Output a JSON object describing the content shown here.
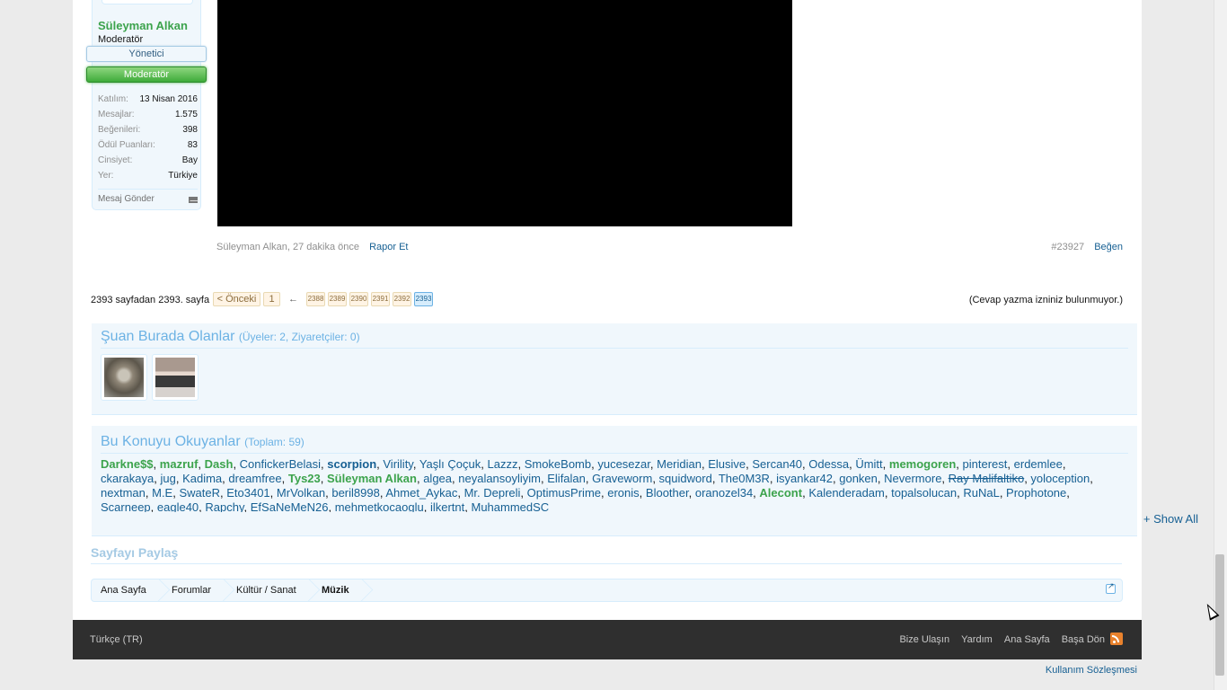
{
  "post": {
    "user": {
      "name": "Süleyman Alkan",
      "title": "Moderatör",
      "banners": [
        "Yönetici",
        "Moderatör"
      ],
      "stats": [
        {
          "label": "Katılım:",
          "value": "13 Nisan 2016"
        },
        {
          "label": "Mesajlar:",
          "value": "1.575"
        },
        {
          "label": "Beğenileri:",
          "value": "398"
        },
        {
          "label": "Ödül Puanları:",
          "value": "83"
        },
        {
          "label": "Cinsiyet:",
          "value": "Bay"
        },
        {
          "label": "Yer:",
          "value": "Türkiye"
        }
      ],
      "send_message": "Mesaj Gönder"
    },
    "meta": {
      "author_time": "Süleyman Alkan, 27 dakika önce",
      "report": "Rapor Et",
      "post_number": "#23927",
      "like": "Beğen"
    }
  },
  "pagination": {
    "label": "2393 sayfadan 2393. sayfa",
    "prev": "< Önceki",
    "first": "1",
    "skip": "←",
    "pages": [
      "2388",
      "2389",
      "2390",
      "2391",
      "2392",
      "2393"
    ],
    "current": "2393",
    "no_reply": "(Cevap yazma izniniz bulunmuyor.)"
  },
  "online": {
    "title": "Şuan Burada Olanlar",
    "count": "(Üyeler: 2, Ziyaretçiler: 0)"
  },
  "readers": {
    "title": "Bu Konuyu Okuyanlar",
    "count": "(Toplam: 59)",
    "users": [
      {
        "n": "Darkne$$",
        "s": "mod"
      },
      {
        "n": "mazruf",
        "s": "mod"
      },
      {
        "n": "Dash",
        "s": "mod"
      },
      {
        "n": "ConfickerBelasi",
        "s": ""
      },
      {
        "n": "scorpion",
        "s": "bold"
      },
      {
        "n": "Virility",
        "s": ""
      },
      {
        "n": "Yaşlı Çoçuk",
        "s": ""
      },
      {
        "n": "Lazzz",
        "s": ""
      },
      {
        "n": "SmokeBomb",
        "s": ""
      },
      {
        "n": "yucesezar",
        "s": ""
      },
      {
        "n": "Meridian",
        "s": ""
      },
      {
        "n": "Elusive",
        "s": ""
      },
      {
        "n": "Sercan40",
        "s": ""
      },
      {
        "n": "Odessa",
        "s": ""
      },
      {
        "n": "Ümitt",
        "s": ""
      },
      {
        "n": "memogoren",
        "s": "mod"
      },
      {
        "n": "pinterest",
        "s": ""
      },
      {
        "n": "erdemlee",
        "s": ""
      },
      {
        "n": "ckarakaya",
        "s": ""
      },
      {
        "n": "jug",
        "s": ""
      },
      {
        "n": "Kadima",
        "s": ""
      },
      {
        "n": "dreamfree",
        "s": ""
      },
      {
        "n": "Tys23",
        "s": "mod"
      },
      {
        "n": "Süleyman Alkan",
        "s": "mod"
      },
      {
        "n": "algea",
        "s": ""
      },
      {
        "n": "neyalansoyliyim",
        "s": ""
      },
      {
        "n": "Elifalan",
        "s": ""
      },
      {
        "n": "Graveworm",
        "s": ""
      },
      {
        "n": "squidword",
        "s": ""
      },
      {
        "n": "The0M3R",
        "s": ""
      },
      {
        "n": "isyankar42",
        "s": ""
      },
      {
        "n": "gonken",
        "s": ""
      },
      {
        "n": "Nevermore",
        "s": ""
      },
      {
        "n": "Ray Malifaltiko",
        "s": "strike"
      },
      {
        "n": "yoloception",
        "s": ""
      },
      {
        "n": "nextman",
        "s": ""
      },
      {
        "n": "M.E",
        "s": ""
      },
      {
        "n": "SwateR",
        "s": ""
      },
      {
        "n": "Eto3401",
        "s": ""
      },
      {
        "n": "MrVolkan",
        "s": ""
      },
      {
        "n": "beril8998",
        "s": ""
      },
      {
        "n": "Ahmet_Aykac",
        "s": ""
      },
      {
        "n": "Mr. Depreli",
        "s": ""
      },
      {
        "n": "OptimusPrime",
        "s": ""
      },
      {
        "n": "eronis",
        "s": ""
      },
      {
        "n": "Bloother",
        "s": ""
      },
      {
        "n": "oranozel34",
        "s": ""
      },
      {
        "n": "Alecont",
        "s": "mod"
      },
      {
        "n": "Kalenderadam",
        "s": ""
      },
      {
        "n": "topalsolucan",
        "s": ""
      },
      {
        "n": "RuNaL",
        "s": ""
      },
      {
        "n": "Prophotone",
        "s": ""
      },
      {
        "n": "Scarneep",
        "s": ""
      },
      {
        "n": "eagle40",
        "s": ""
      },
      {
        "n": "Rapchy",
        "s": ""
      },
      {
        "n": "EfSaNeMeN26",
        "s": ""
      },
      {
        "n": "mehmetkocaoglu",
        "s": ""
      },
      {
        "n": "ilkertnt",
        "s": ""
      },
      {
        "n": "MuhammedSC",
        "s": ""
      }
    ],
    "show_all": "+ Show All"
  },
  "share": {
    "title": "Sayfayı Paylaş"
  },
  "breadcrumb": [
    "Ana Sayfa",
    "Forumlar",
    "Kültür / Sanat",
    "Müzik"
  ],
  "footer": {
    "language": "Türkçe (TR)",
    "links": [
      "Bize Ulaşın",
      "Yardım",
      "Ana Sayfa",
      "Başa Dön"
    ],
    "terms": "Kullanım Sözleşmesi"
  },
  "colors": {
    "accent": "#176093",
    "moderator_green": "#3ca34c",
    "footer_bg": "#2f2f2f",
    "link_blue": "#6cb2e4"
  }
}
